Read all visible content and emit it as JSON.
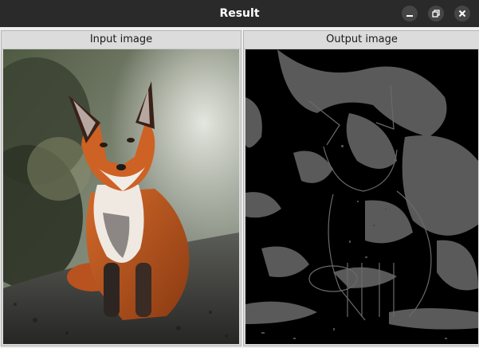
{
  "window": {
    "title": "Result",
    "controls": {
      "minimize_icon": "minimize-icon",
      "maximize_icon": "restore-icon",
      "close_icon": "close-icon"
    }
  },
  "panels": [
    {
      "label": "Input image",
      "image": "color photo of a red fox sitting on a path"
    },
    {
      "label": "Output image",
      "image": "edge-detected black and gray version of the fox photo"
    }
  ],
  "colors": {
    "titlebar": "#2a2a2a",
    "header_bg": "#dcdcdc",
    "fox_orange": "#c65a1e",
    "output_gray": "#5a5a5a",
    "output_black": "#000000"
  }
}
